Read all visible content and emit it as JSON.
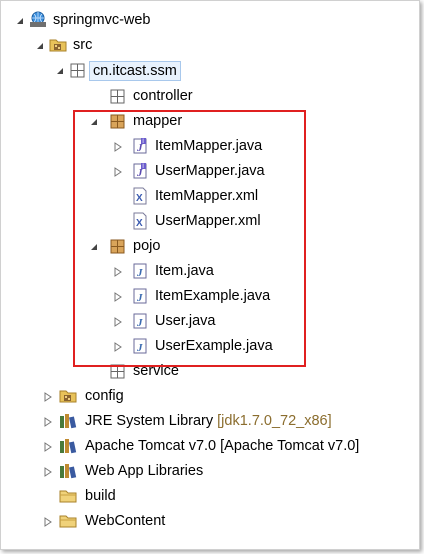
{
  "tree": {
    "project": "springmvc-web",
    "src": "src",
    "package_main": "cn.itcast.ssm",
    "pkg_controller": "controller",
    "pkg_mapper": "mapper",
    "mapper_files": [
      "ItemMapper.java",
      "UserMapper.java",
      "ItemMapper.xml",
      "UserMapper.xml"
    ],
    "pkg_pojo": "pojo",
    "pojo_files": [
      "Item.java",
      "ItemExample.java",
      "User.java",
      "UserExample.java"
    ],
    "pkg_service": "service",
    "config": "config",
    "jre_label": "JRE System Library",
    "jre_decoration": "[jdk1.7.0_72_x86]",
    "tomcat": "Apache Tomcat v7.0 [Apache Tomcat v7.0]",
    "webapp_libs": "Web App Libraries",
    "build": "build",
    "webcontent": "WebContent"
  },
  "colors": {
    "highlight_border": "#e02020",
    "selection_bg": "#e8f2fd",
    "decoration_text": "#8b6d2e"
  },
  "icons": {
    "project": "web-project-icon",
    "source_folder": "source-folder-icon",
    "package": "package-icon",
    "java_interface": "java-interface-icon",
    "java_class": "java-class-icon",
    "xml_file": "xml-file-icon",
    "library": "library-icon",
    "folder": "folder-icon"
  }
}
